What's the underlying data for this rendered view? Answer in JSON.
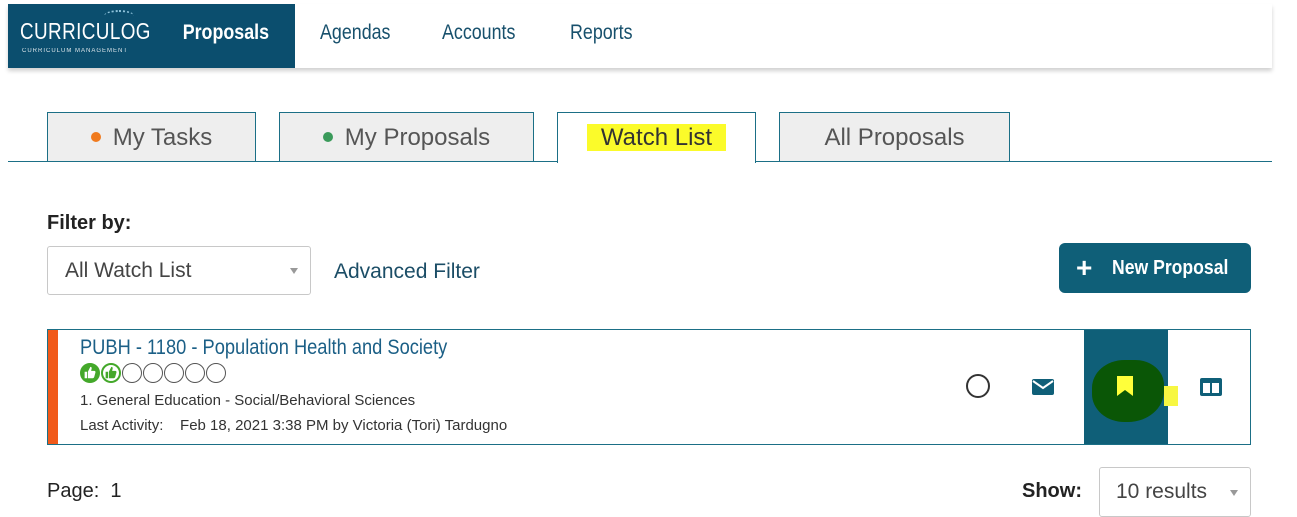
{
  "app": {
    "logo_title": "CURRICULOG",
    "logo_subtitle": "CURRICULUM MANAGEMENT"
  },
  "nav": {
    "items": [
      {
        "label": "Proposals",
        "active": true
      },
      {
        "label": "Agendas"
      },
      {
        "label": "Accounts"
      },
      {
        "label": "Reports"
      }
    ]
  },
  "tabs": [
    {
      "label": "My Tasks",
      "dot_color": "#f07a1e"
    },
    {
      "label": "My Proposals",
      "dot_color": "#3a9a5a"
    },
    {
      "label": "Watch List",
      "active": true
    },
    {
      "label": "All Proposals"
    }
  ],
  "filter": {
    "label": "Filter by:",
    "selected": "All Watch List",
    "advanced_label": "Advanced Filter"
  },
  "new_proposal_label": "New Proposal",
  "proposals": [
    {
      "title": "PUBH - 1180 - Population Health and Society",
      "approvals_done": 2,
      "approvals_total": 7,
      "category": "1. General Education - Social/Behavioral Sciences",
      "last_activity_label": "Last Activity:",
      "last_activity": "Feb 18, 2021 3:38 PM by Victoria (Tori) Tardugno"
    }
  ],
  "pagination": {
    "page_label": "Page:",
    "page": "1",
    "show_label": "Show:",
    "show_value": "10 results"
  },
  "colors": {
    "brand": "#0b4e6e",
    "accent_stripe": "#f15a1a",
    "highlight": "#fbfb2a"
  }
}
